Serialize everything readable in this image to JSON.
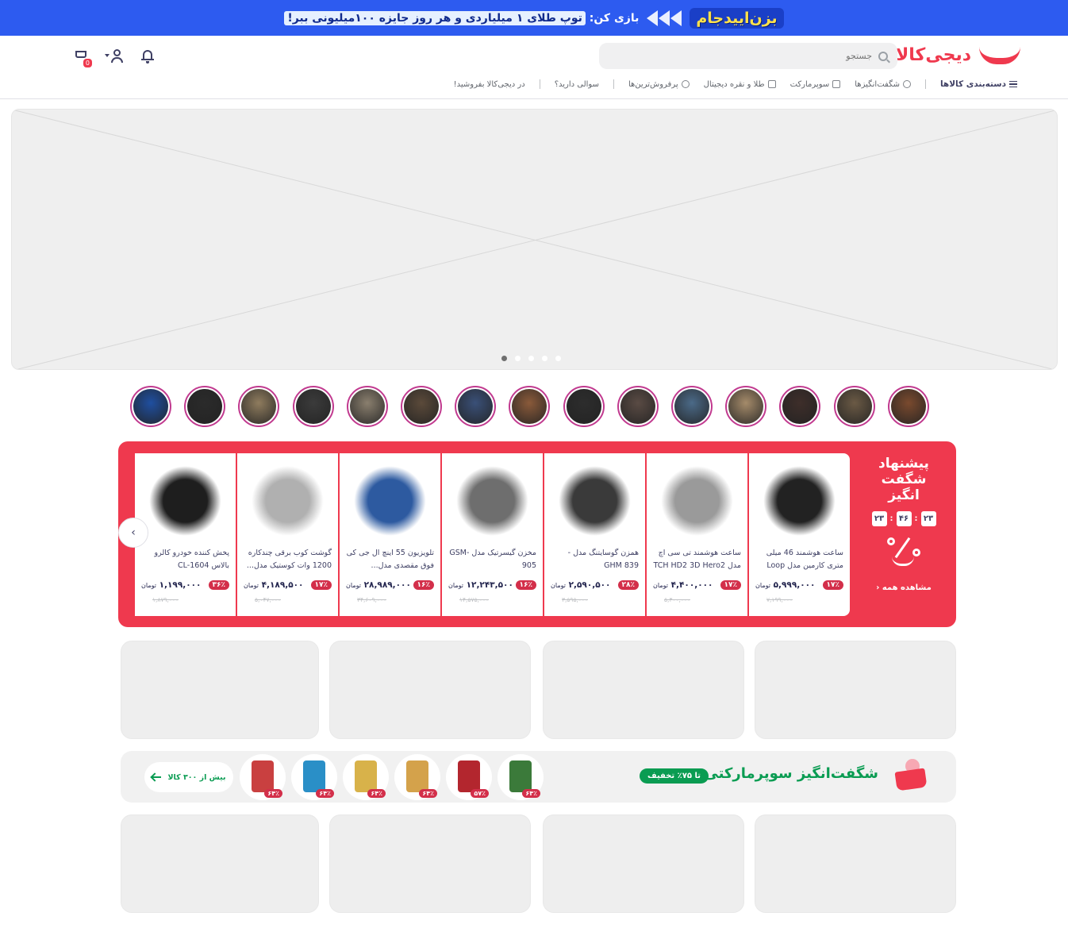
{
  "promo": {
    "logo": "بزن‌ایید‌جام",
    "text_prefix": "بازی کن:",
    "text_highlight": "توپ طلای ۱ میلیاردی و هر روز جایزه ۱۰۰میلیونی ببر!"
  },
  "header": {
    "logo": "دیجی‌کالا",
    "search_placeholder": "جستجو",
    "cart_count": "0"
  },
  "nav": {
    "items": [
      {
        "label": "دسته‌بندی کالاها",
        "icon": "menu-icon"
      },
      {
        "label": "شگفت‌انگیزها",
        "icon": "question-icon"
      },
      {
        "label": "سوپرمارکت",
        "icon": "basket-icon"
      },
      {
        "label": "طلا و نقره دیجیتال",
        "icon": "gold-icon"
      },
      {
        "label": "پرفروش‌ترین‌ها",
        "icon": "fire-icon"
      },
      {
        "label": "سوالی دارید؟",
        "icon": ""
      },
      {
        "label": "در دیجی‌کالا بفروشید!",
        "icon": ""
      }
    ]
  },
  "hero": {
    "active_slide": 1,
    "slide_count": 5
  },
  "stories": {
    "colors": [
      "#7a4a2e",
      "#6b5a45",
      "#3e2e2a",
      "#a58b6a",
      "#4b6a88",
      "#5a4b44",
      "#2d2d2d",
      "#8a5a3a",
      "#3a5078",
      "#5b4a3a",
      "#8a7f6e",
      "#3b3b3b",
      "#8f7c5e",
      "#2b2b2b",
      "#1f4fa0"
    ]
  },
  "amazing": {
    "title_line1": "پیشنهاد",
    "title_line2": "شگفت",
    "title_line3": "انگیز",
    "timer": [
      "۲۳",
      "۴۶",
      "۲۳"
    ],
    "see_all": "مشاهده همه",
    "currency": "تومان",
    "products": [
      {
        "name": "ساعت هوشمند 46 میلی متری کارمین مدل Loop دیجی",
        "discount": "۱۷٪",
        "price": "۵,۹۹۹,۰۰۰",
        "old": "۷,۱۹۹,۰۰۰",
        "img_color": "#222222"
      },
      {
        "name": "ساعت هوشمند تی سی اچ مدل TCH HD2 3D Hero2 ....",
        "discount": "۱۷٪",
        "price": "۴,۴۰۰,۰۰۰",
        "old": "۵,۳۰۰,۰۰۰",
        "img_color": "#9a9a9a"
      },
      {
        "name": "همزن گوسایتنگ مدل -GHM 839",
        "discount": "۲۸٪",
        "price": "۲,۵۹۰,۵۰۰",
        "old": "۳,۵۹۵,۰۰۰",
        "img_color": "#3a3a3a"
      },
      {
        "name": "مخزن گیسرتیک مدل -GSM 905",
        "discount": "۱۶٪",
        "price": "۱۲,۲۴۳,۵۰۰",
        "old": "۱۴,۵۷۵,۰۰۰",
        "img_color": "#6e6e6e"
      },
      {
        "name": "تلویزیون 55 اینچ ال جی کی فوق مقصدی مدل...",
        "discount": "۱۶٪",
        "price": "۲۸,۹۸۹,۰۰۰",
        "old": "۳۴,۶۰۹,۰۰۰",
        "img_color": "#2d5aa0"
      },
      {
        "name": "گوشت کوب برقی چندکاره 1200 وات کوستیک مدل...",
        "discount": "۱۷٪",
        "price": "۴,۱۸۹,۵۰۰",
        "old": "۵,۰۴۷,۰۰۰",
        "img_color": "#b0b0b0"
      },
      {
        "name": "پخش کننده خودرو کالرو بالاس CL-1604",
        "discount": "۳۶٪",
        "price": "۱,۱۹۹,۰۰۰",
        "old": "۱,۸۷۹,۰۰۰",
        "img_color": "#1e1e1e"
      }
    ]
  },
  "supermarket": {
    "title": "شگفت‌انگیز سوپرمارکتی",
    "pill": "تا ۷۵٪ تخفیف",
    "more": "بیش از ۳۰۰ کالا",
    "items": [
      {
        "discount": "۶۴٪",
        "color": "#3b7a3a"
      },
      {
        "discount": "۵۷٪",
        "color": "#b3262e"
      },
      {
        "discount": "۶۴٪",
        "color": "#d4a24b"
      },
      {
        "discount": "۶۴٪",
        "color": "#d8b24a"
      },
      {
        "discount": "۶۴٪",
        "color": "#2a8fc7"
      },
      {
        "discount": "۶۴٪",
        "color": "#c94040"
      }
    ]
  }
}
